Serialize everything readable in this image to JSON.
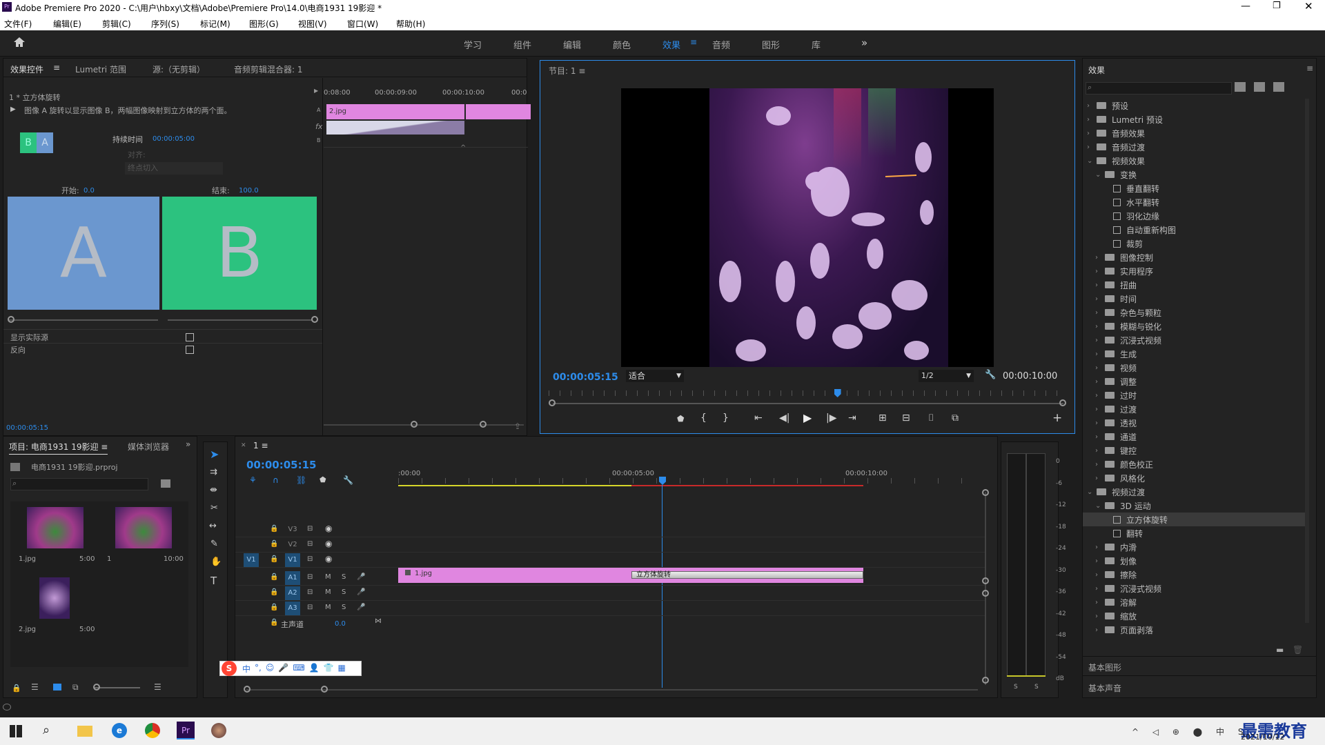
{
  "window": {
    "title": "Adobe Premiere Pro 2020 - C:\\用户\\hbxy\\文档\\Adobe\\Premiere Pro\\14.0\\电商1931 19影迎 *",
    "app_icon": "Pr"
  },
  "menu": [
    "文件(F)",
    "编辑(E)",
    "剪辑(C)",
    "序列(S)",
    "标记(M)",
    "图形(G)",
    "视图(V)",
    "窗口(W)",
    "帮助(H)"
  ],
  "workspaces": [
    "学习",
    "组件",
    "编辑",
    "颜色",
    "效果",
    "音频",
    "图形",
    "库"
  ],
  "active_workspace": "效果",
  "effect_controls": {
    "tabs": [
      "效果控件",
      "Lumetri 范围",
      "源:（无剪辑）",
      "音频剪辑混合器: 1"
    ],
    "clip_title": "1 * 立方体旋转",
    "description": "图像 A 旋转以显示图像 B，两幅图像映射到立方体的两个面。",
    "duration_label": "持续时间",
    "duration_value": "00:00:05:00",
    "align_label": "对齐:",
    "align_value": "终点切入",
    "start_label": "开始:",
    "start_value": "0.0",
    "end_label": "结束:",
    "end_value": "100.0",
    "letter_a": "A",
    "letter_b": "B",
    "show_source": "显示实际源",
    "reverse": "反向",
    "mini_times": [
      "0:08:00",
      "00:00:09:00",
      "00:00:10:00",
      "00:0"
    ],
    "mini_clip": "2.jpg",
    "timecode": "00:00:05:15",
    "color_a": "#6b97cf",
    "color_b": "#2cc27f"
  },
  "program": {
    "tab": "节目: 1",
    "timecode": "00:00:05:15",
    "fit": "适合",
    "res": "1/2",
    "duration": "00:00:10:00",
    "playhead_fraction": 0.55
  },
  "project": {
    "tabs": [
      "项目: 电商1931 19影迎",
      "媒体浏览器"
    ],
    "file": "电商1931 19影迎.prproj",
    "items": [
      {
        "name": "1.jpg",
        "dur": "5:00"
      },
      {
        "name": "1",
        "dur": "10:00"
      },
      {
        "name": "2.jpg",
        "dur": "5:00"
      }
    ]
  },
  "timeline": {
    "tab": "1",
    "timecode": "00:00:05:15",
    "ruler": [
      ":00:00",
      "00:00:05:00",
      "00:00:10:00"
    ],
    "tracks": [
      "V3",
      "V2",
      "V1",
      "A1",
      "A2",
      "A3"
    ],
    "master": "主声道",
    "master_value": "0.0",
    "clip1": "1.jpg",
    "transition": "立方体旋转",
    "toggle_m": "M",
    "toggle_s": "S",
    "src_v1": "V1"
  },
  "meter": {
    "labels": [
      "0",
      "-6",
      "-12",
      "-18",
      "-24",
      "-30",
      "-36",
      "-42",
      "-48",
      "-54",
      "dB"
    ],
    "s1": "S",
    "s2": "S"
  },
  "effects": {
    "title": "效果",
    "tree": [
      {
        "t": "预设",
        "lvl": 0,
        "kind": "folder",
        "open": false
      },
      {
        "t": "Lumetri 预设",
        "lvl": 0,
        "kind": "folder",
        "open": false
      },
      {
        "t": "音频效果",
        "lvl": 0,
        "kind": "folder",
        "open": false
      },
      {
        "t": "音频过渡",
        "lvl": 0,
        "kind": "folder",
        "open": false
      },
      {
        "t": "视频效果",
        "lvl": 0,
        "kind": "folder",
        "open": true
      },
      {
        "t": "变换",
        "lvl": 1,
        "kind": "folder",
        "open": true
      },
      {
        "t": "垂直翻转",
        "lvl": 2,
        "kind": "fx"
      },
      {
        "t": "水平翻转",
        "lvl": 2,
        "kind": "fx"
      },
      {
        "t": "羽化边缘",
        "lvl": 2,
        "kind": "fx"
      },
      {
        "t": "自动重新构图",
        "lvl": 2,
        "kind": "fx"
      },
      {
        "t": "裁剪",
        "lvl": 2,
        "kind": "fx"
      },
      {
        "t": "图像控制",
        "lvl": 1,
        "kind": "folder",
        "open": false
      },
      {
        "t": "实用程序",
        "lvl": 1,
        "kind": "folder",
        "open": false
      },
      {
        "t": "扭曲",
        "lvl": 1,
        "kind": "folder",
        "open": false
      },
      {
        "t": "时间",
        "lvl": 1,
        "kind": "folder",
        "open": false
      },
      {
        "t": "杂色与颗粒",
        "lvl": 1,
        "kind": "folder",
        "open": false
      },
      {
        "t": "模糊与锐化",
        "lvl": 1,
        "kind": "folder",
        "open": false
      },
      {
        "t": "沉浸式视频",
        "lvl": 1,
        "kind": "folder",
        "open": false
      },
      {
        "t": "生成",
        "lvl": 1,
        "kind": "folder",
        "open": false
      },
      {
        "t": "视频",
        "lvl": 1,
        "kind": "folder",
        "open": false
      },
      {
        "t": "调整",
        "lvl": 1,
        "kind": "folder",
        "open": false
      },
      {
        "t": "过时",
        "lvl": 1,
        "kind": "folder",
        "open": false
      },
      {
        "t": "过渡",
        "lvl": 1,
        "kind": "folder",
        "open": false
      },
      {
        "t": "透视",
        "lvl": 1,
        "kind": "folder",
        "open": false
      },
      {
        "t": "通道",
        "lvl": 1,
        "kind": "folder",
        "open": false
      },
      {
        "t": "键控",
        "lvl": 1,
        "kind": "folder",
        "open": false
      },
      {
        "t": "颜色校正",
        "lvl": 1,
        "kind": "folder",
        "open": false
      },
      {
        "t": "风格化",
        "lvl": 1,
        "kind": "folder",
        "open": false
      },
      {
        "t": "视频过渡",
        "lvl": 0,
        "kind": "folder",
        "open": true
      },
      {
        "t": "3D 运动",
        "lvl": 1,
        "kind": "folder",
        "open": true
      },
      {
        "t": "立方体旋转",
        "lvl": 2,
        "kind": "fx",
        "selected": true
      },
      {
        "t": "翻转",
        "lvl": 2,
        "kind": "fx"
      },
      {
        "t": "内滑",
        "lvl": 1,
        "kind": "folder",
        "open": false
      },
      {
        "t": "划像",
        "lvl": 1,
        "kind": "folder",
        "open": false
      },
      {
        "t": "擦除",
        "lvl": 1,
        "kind": "folder",
        "open": false
      },
      {
        "t": "沉浸式视频",
        "lvl": 1,
        "kind": "folder",
        "open": false
      },
      {
        "t": "溶解",
        "lvl": 1,
        "kind": "folder",
        "open": false
      },
      {
        "t": "缩放",
        "lvl": 1,
        "kind": "folder",
        "open": false
      },
      {
        "t": "页面剥落",
        "lvl": 1,
        "kind": "folder",
        "open": false
      }
    ],
    "basic_graphics": "基本图形",
    "basic_sound": "基本声音"
  },
  "ime": {
    "items": [
      "中",
      "°,",
      "☺",
      "🎤",
      "⌨",
      "👤",
      "👕",
      "▦"
    ]
  },
  "taskbar": {
    "date": "2021/10/12",
    "watermark": "最需教育"
  }
}
